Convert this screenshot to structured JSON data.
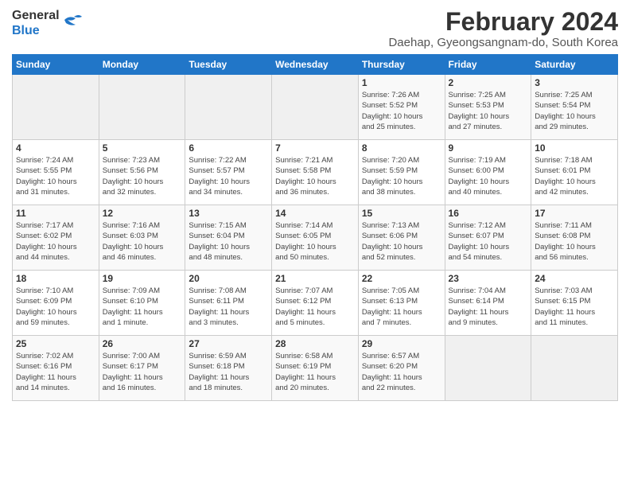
{
  "header": {
    "logo_line1": "General",
    "logo_line2": "Blue",
    "title": "February 2024",
    "subtitle": "Daehap, Gyeongsangnam-do, South Korea"
  },
  "days_of_week": [
    "Sunday",
    "Monday",
    "Tuesday",
    "Wednesday",
    "Thursday",
    "Friday",
    "Saturday"
  ],
  "weeks": [
    [
      {
        "day": "",
        "info": ""
      },
      {
        "day": "",
        "info": ""
      },
      {
        "day": "",
        "info": ""
      },
      {
        "day": "",
        "info": ""
      },
      {
        "day": "1",
        "info": "Sunrise: 7:26 AM\nSunset: 5:52 PM\nDaylight: 10 hours\nand 25 minutes."
      },
      {
        "day": "2",
        "info": "Sunrise: 7:25 AM\nSunset: 5:53 PM\nDaylight: 10 hours\nand 27 minutes."
      },
      {
        "day": "3",
        "info": "Sunrise: 7:25 AM\nSunset: 5:54 PM\nDaylight: 10 hours\nand 29 minutes."
      }
    ],
    [
      {
        "day": "4",
        "info": "Sunrise: 7:24 AM\nSunset: 5:55 PM\nDaylight: 10 hours\nand 31 minutes."
      },
      {
        "day": "5",
        "info": "Sunrise: 7:23 AM\nSunset: 5:56 PM\nDaylight: 10 hours\nand 32 minutes."
      },
      {
        "day": "6",
        "info": "Sunrise: 7:22 AM\nSunset: 5:57 PM\nDaylight: 10 hours\nand 34 minutes."
      },
      {
        "day": "7",
        "info": "Sunrise: 7:21 AM\nSunset: 5:58 PM\nDaylight: 10 hours\nand 36 minutes."
      },
      {
        "day": "8",
        "info": "Sunrise: 7:20 AM\nSunset: 5:59 PM\nDaylight: 10 hours\nand 38 minutes."
      },
      {
        "day": "9",
        "info": "Sunrise: 7:19 AM\nSunset: 6:00 PM\nDaylight: 10 hours\nand 40 minutes."
      },
      {
        "day": "10",
        "info": "Sunrise: 7:18 AM\nSunset: 6:01 PM\nDaylight: 10 hours\nand 42 minutes."
      }
    ],
    [
      {
        "day": "11",
        "info": "Sunrise: 7:17 AM\nSunset: 6:02 PM\nDaylight: 10 hours\nand 44 minutes."
      },
      {
        "day": "12",
        "info": "Sunrise: 7:16 AM\nSunset: 6:03 PM\nDaylight: 10 hours\nand 46 minutes."
      },
      {
        "day": "13",
        "info": "Sunrise: 7:15 AM\nSunset: 6:04 PM\nDaylight: 10 hours\nand 48 minutes."
      },
      {
        "day": "14",
        "info": "Sunrise: 7:14 AM\nSunset: 6:05 PM\nDaylight: 10 hours\nand 50 minutes."
      },
      {
        "day": "15",
        "info": "Sunrise: 7:13 AM\nSunset: 6:06 PM\nDaylight: 10 hours\nand 52 minutes."
      },
      {
        "day": "16",
        "info": "Sunrise: 7:12 AM\nSunset: 6:07 PM\nDaylight: 10 hours\nand 54 minutes."
      },
      {
        "day": "17",
        "info": "Sunrise: 7:11 AM\nSunset: 6:08 PM\nDaylight: 10 hours\nand 56 minutes."
      }
    ],
    [
      {
        "day": "18",
        "info": "Sunrise: 7:10 AM\nSunset: 6:09 PM\nDaylight: 10 hours\nand 59 minutes."
      },
      {
        "day": "19",
        "info": "Sunrise: 7:09 AM\nSunset: 6:10 PM\nDaylight: 11 hours\nand 1 minute."
      },
      {
        "day": "20",
        "info": "Sunrise: 7:08 AM\nSunset: 6:11 PM\nDaylight: 11 hours\nand 3 minutes."
      },
      {
        "day": "21",
        "info": "Sunrise: 7:07 AM\nSunset: 6:12 PM\nDaylight: 11 hours\nand 5 minutes."
      },
      {
        "day": "22",
        "info": "Sunrise: 7:05 AM\nSunset: 6:13 PM\nDaylight: 11 hours\nand 7 minutes."
      },
      {
        "day": "23",
        "info": "Sunrise: 7:04 AM\nSunset: 6:14 PM\nDaylight: 11 hours\nand 9 minutes."
      },
      {
        "day": "24",
        "info": "Sunrise: 7:03 AM\nSunset: 6:15 PM\nDaylight: 11 hours\nand 11 minutes."
      }
    ],
    [
      {
        "day": "25",
        "info": "Sunrise: 7:02 AM\nSunset: 6:16 PM\nDaylight: 11 hours\nand 14 minutes."
      },
      {
        "day": "26",
        "info": "Sunrise: 7:00 AM\nSunset: 6:17 PM\nDaylight: 11 hours\nand 16 minutes."
      },
      {
        "day": "27",
        "info": "Sunrise: 6:59 AM\nSunset: 6:18 PM\nDaylight: 11 hours\nand 18 minutes."
      },
      {
        "day": "28",
        "info": "Sunrise: 6:58 AM\nSunset: 6:19 PM\nDaylight: 11 hours\nand 20 minutes."
      },
      {
        "day": "29",
        "info": "Sunrise: 6:57 AM\nSunset: 6:20 PM\nDaylight: 11 hours\nand 22 minutes."
      },
      {
        "day": "",
        "info": ""
      },
      {
        "day": "",
        "info": ""
      }
    ]
  ]
}
